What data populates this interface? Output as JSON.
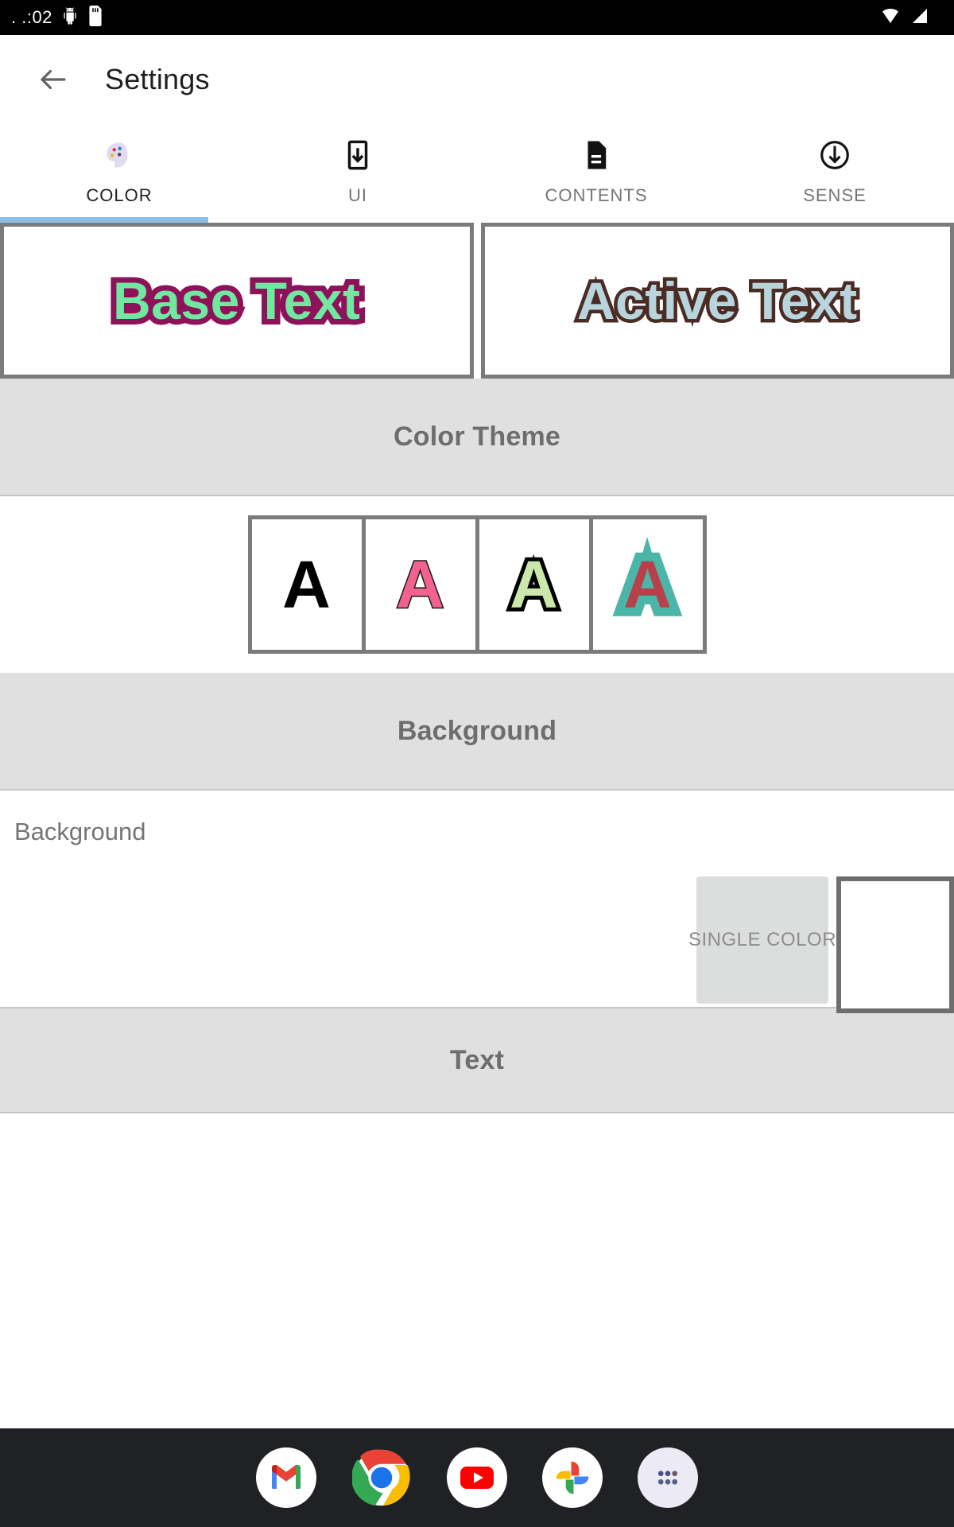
{
  "statusbar": {
    "clock": ". .:02",
    "left_icons": [
      "android-bug-icon",
      "sd-card-icon"
    ],
    "right_icons": [
      "wifi-icon",
      "cell-signal-icon"
    ]
  },
  "appbar": {
    "back_icon": "back-arrow-icon",
    "title": "Settings"
  },
  "tabs": {
    "active_index": 0,
    "items": [
      {
        "label": "COLOR",
        "icon": "palette-icon"
      },
      {
        "label": "UI",
        "icon": "phone-download-icon"
      },
      {
        "label": "CONTENTS",
        "icon": "document-icon"
      },
      {
        "label": "SENSE",
        "icon": "circle-download-icon"
      }
    ]
  },
  "preview": {
    "base": {
      "text": "Base Text",
      "fill_color": "#6fe9a0",
      "outline_color": "#8e1259"
    },
    "active": {
      "text": "Active Text",
      "fill_color": "#b8d4dc",
      "outline_color": "#4a2c25"
    }
  },
  "sections": {
    "color_theme": {
      "title": "Color Theme",
      "swatches": [
        {
          "glyph": "A",
          "fill_color": "#000000",
          "outline_color": "#000000"
        },
        {
          "glyph": "A",
          "fill_color": "#f2628f",
          "outline_color": "#1a1a1a"
        },
        {
          "glyph": "A",
          "fill_color": "#cbe7ac",
          "outline_color": "#000000"
        },
        {
          "glyph": "A",
          "fill_color": "#b8404a",
          "outline_color": "#4bb5a8"
        }
      ],
      "selected_index": 3
    },
    "background": {
      "title": "Background",
      "row_label": "Background",
      "single_color_label": "SINGLE COLOR",
      "swatch_color": "#ffffff"
    },
    "text": {
      "title": "Text"
    }
  },
  "navbar": {
    "items": [
      {
        "name": "gmail"
      },
      {
        "name": "chrome"
      },
      {
        "name": "youtube"
      },
      {
        "name": "google-photos"
      },
      {
        "name": "app-drawer"
      }
    ]
  },
  "theme": {
    "accent": "#8ebde4",
    "section_bg": "#e0e0e0",
    "border": "#7b7b7b"
  }
}
